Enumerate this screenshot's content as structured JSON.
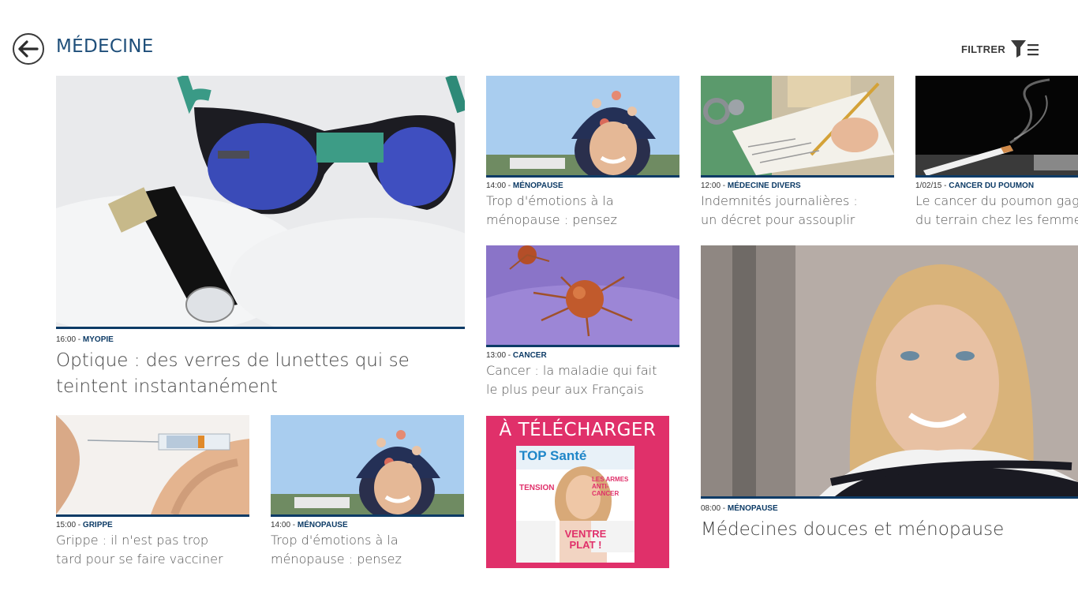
{
  "header": {
    "title": "MÉDECINE",
    "filter_label": "FILTRER"
  },
  "articles": [
    {
      "time": "16:00",
      "category": "MYOPIE",
      "title": "Optique : des verres de lunettes qui se teintent instantanément"
    },
    {
      "time": "14:00",
      "category": "MÉNOPAUSE",
      "title": "Trop d'émotions à la ménopause : pensez aux..."
    },
    {
      "time": "12:00",
      "category": "MÉDECINE DIVERS",
      "title": "Indemnités journalières : un décret pour assouplir les..."
    },
    {
      "time": "1/02/15",
      "category": "CANCER DU POUMON",
      "title": "Le cancer du poumon gagne du terrain chez les femmes"
    },
    {
      "time": "13:00",
      "category": "CANCER",
      "title": "Cancer : la maladie qui fait le plus peur aux Français"
    },
    {
      "time": "08:00",
      "category": "MÉNOPAUSE",
      "title": "Médecines douces et ménopause"
    },
    {
      "time": "15:00",
      "category": "GRIPPE",
      "title": "Grippe : il n'est pas trop tard pour se faire vacciner"
    },
    {
      "time": "14:00",
      "category": "MÉNOPAUSE",
      "title": "Trop d'émotions à la ménopause : pensez aux..."
    }
  ],
  "promo": {
    "title": "À TÉLÉCHARGER",
    "cover_masthead": "TOP Santé",
    "cover_lines": [
      "TENSION",
      "LES ARMES ANTI-CANCER",
      "VENTRE PLAT !"
    ]
  },
  "sep": " - ",
  "colors": {
    "title": "#1f4f7a",
    "category": "#0d3b66",
    "promo": "#e0306a"
  }
}
